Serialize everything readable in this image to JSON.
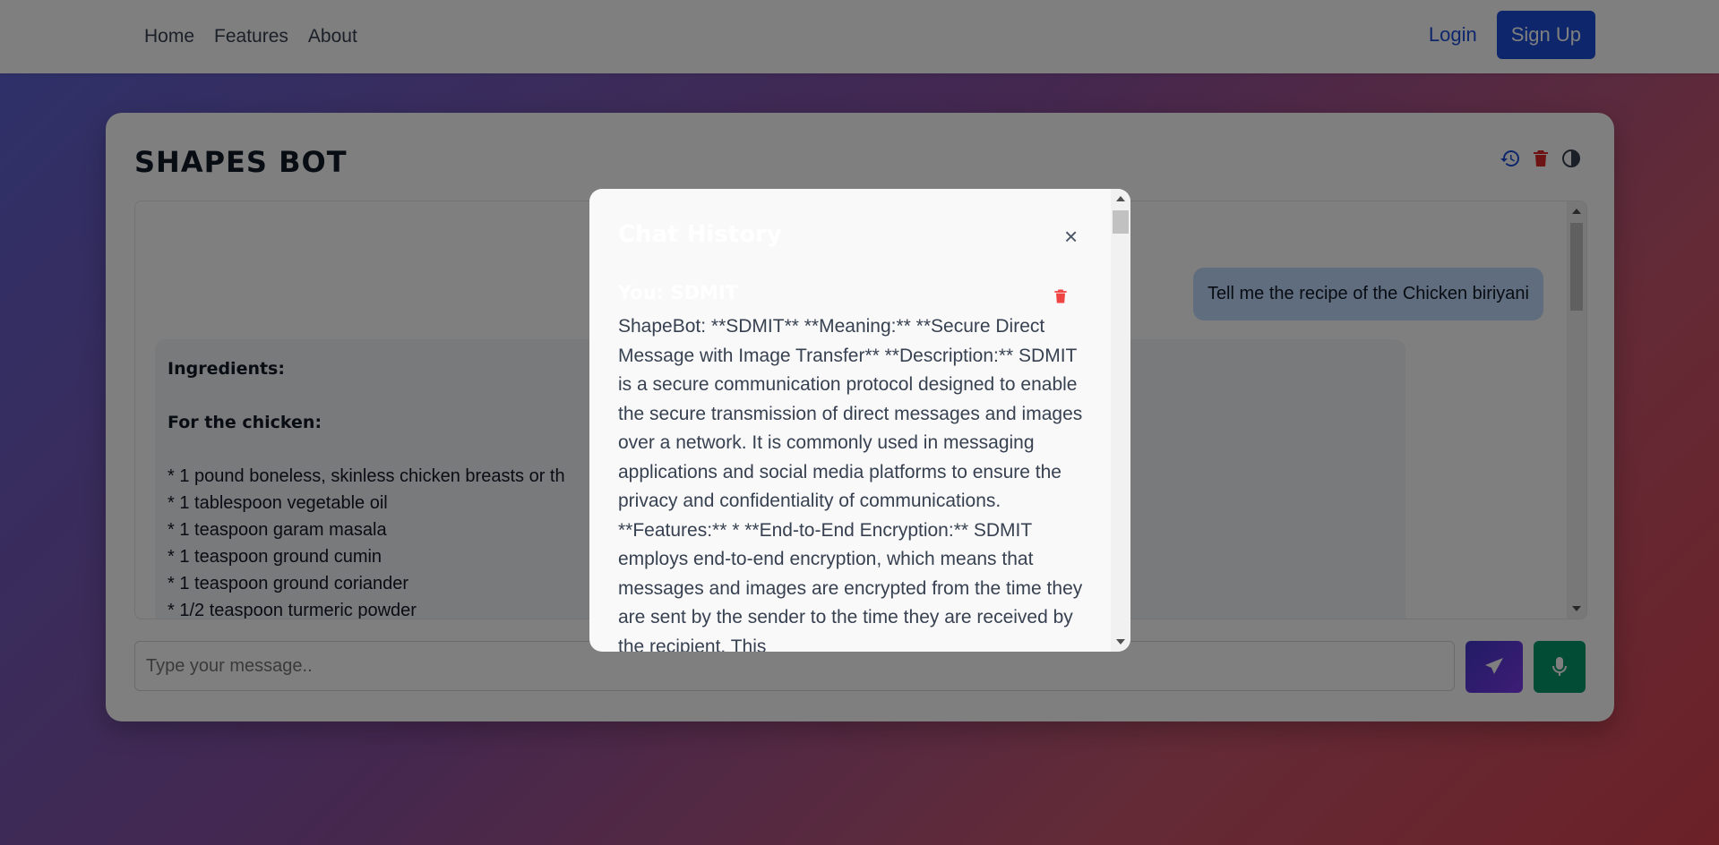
{
  "nav": {
    "links": [
      "Home",
      "Features",
      "About"
    ],
    "login": "Login",
    "signup": "Sign Up"
  },
  "card": {
    "title": "SHAPES BOT",
    "icons": [
      "history-icon",
      "trash-icon",
      "contrast-icon"
    ]
  },
  "chat": {
    "user_message": "Tell me the recipe of the Chicken biriyani",
    "bot_heading": "Ingredients:",
    "bot_subheading": "For the chicken:",
    "bot_lines": [
      "* 1 pound boneless, skinless chicken breasts or th",
      "* 1 tablespoon vegetable oil",
      "* 1 teaspoon garam masala",
      "* 1 teaspoon ground cumin",
      "* 1 teaspoon ground coriander",
      "* 1/2 teaspoon turmeric powder"
    ]
  },
  "input": {
    "placeholder": "Type your message.."
  },
  "modal": {
    "title": "Chat History",
    "close": "×",
    "entry_you": "You: SDMIT",
    "entry_bot": "ShapeBot: **SDMIT** **Meaning:** **Secure Direct Message with Image Transfer** **Description:** SDMIT is a secure communication protocol designed to enable the secure transmission of direct messages and images over a network. It is commonly used in messaging applications and social media platforms to ensure the privacy and confidentiality of communications. **Features:** * **End-to-End Encryption:** SDMIT employs end-to-end encryption, which means that messages and images are encrypted from the time they are sent by the sender to the time they are received by the recipient. This"
  },
  "colors": {
    "primary": "#1d4ed8",
    "danger": "#ef4444",
    "mic": "#059669",
    "user_bubble": "#bfdbfe"
  }
}
